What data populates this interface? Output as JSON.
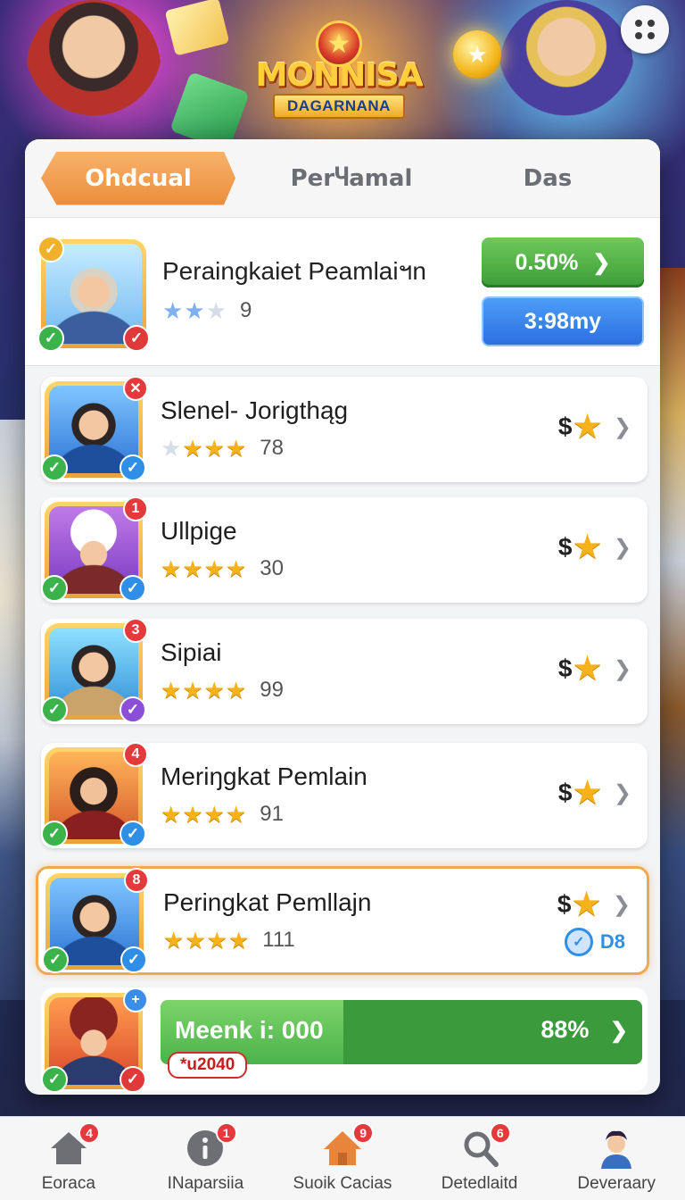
{
  "header": {
    "logo_title": "MONNISA",
    "logo_subtitle": "DAGARNANA"
  },
  "tabs": [
    {
      "label": "Ohdcual",
      "active": true
    },
    {
      "label": "PerႷamal",
      "active": false
    },
    {
      "label": "Das",
      "active": false
    }
  ],
  "featured": {
    "name": "Peraingkaiet Peamlaiฯn",
    "score": "9",
    "stars": [
      "blue",
      "blue",
      "empty"
    ],
    "percent_button": "0.50%",
    "time_button": "3:98my"
  },
  "rows": [
    {
      "name": "Slenel- Jorigthąg",
      "stars": [
        "empty",
        "gold",
        "gold",
        "gold"
      ],
      "score": "78",
      "reward": "$",
      "corner": "✕"
    },
    {
      "name": "Ullpige",
      "stars": [
        "gold",
        "gold",
        "gold",
        "gold"
      ],
      "score": "30",
      "reward": "$",
      "corner": "1"
    },
    {
      "name": "Sipiai",
      "stars": [
        "gold",
        "gold",
        "gold",
        "gold"
      ],
      "score": "99",
      "reward": "$",
      "corner": "3"
    },
    {
      "name": "Meriŋgkat Pemlain",
      "stars": [
        "gold",
        "gold",
        "gold",
        "gold"
      ],
      "score": "91",
      "reward": "$",
      "corner": "4"
    },
    {
      "name": "Peringkat Pemllajn",
      "stars": [
        "gold",
        "gold",
        "gold",
        "gold"
      ],
      "score": "111",
      "reward": "$",
      "corner": "8",
      "verified_label": "D8",
      "highlight": true
    }
  ],
  "progress": {
    "label": "Meenk i: 000",
    "percent_text": "88%",
    "fill": 0.38,
    "tag": "*u2040",
    "corner": "+"
  },
  "nav": [
    {
      "label": "Eoraca",
      "badge": "4",
      "icon": "home-icon"
    },
    {
      "label": "INaparsiia",
      "badge": "1",
      "icon": "info-icon"
    },
    {
      "label": "Suoik Cacias",
      "badge": "9",
      "icon": "house-orange-icon"
    },
    {
      "label": "Detedlaitd",
      "badge": "6",
      "icon": "search-icon"
    },
    {
      "label": "Deveraary",
      "badge": "",
      "icon": "profile-avatar-icon"
    }
  ],
  "colors": {
    "tab_active": "#ec8d3b",
    "green_button": "#3b9c37",
    "blue_button": "#2c6fe0",
    "star_gold": "#f6b21b",
    "badge_red": "#e5393b",
    "highlight_border": "#f0a951"
  }
}
